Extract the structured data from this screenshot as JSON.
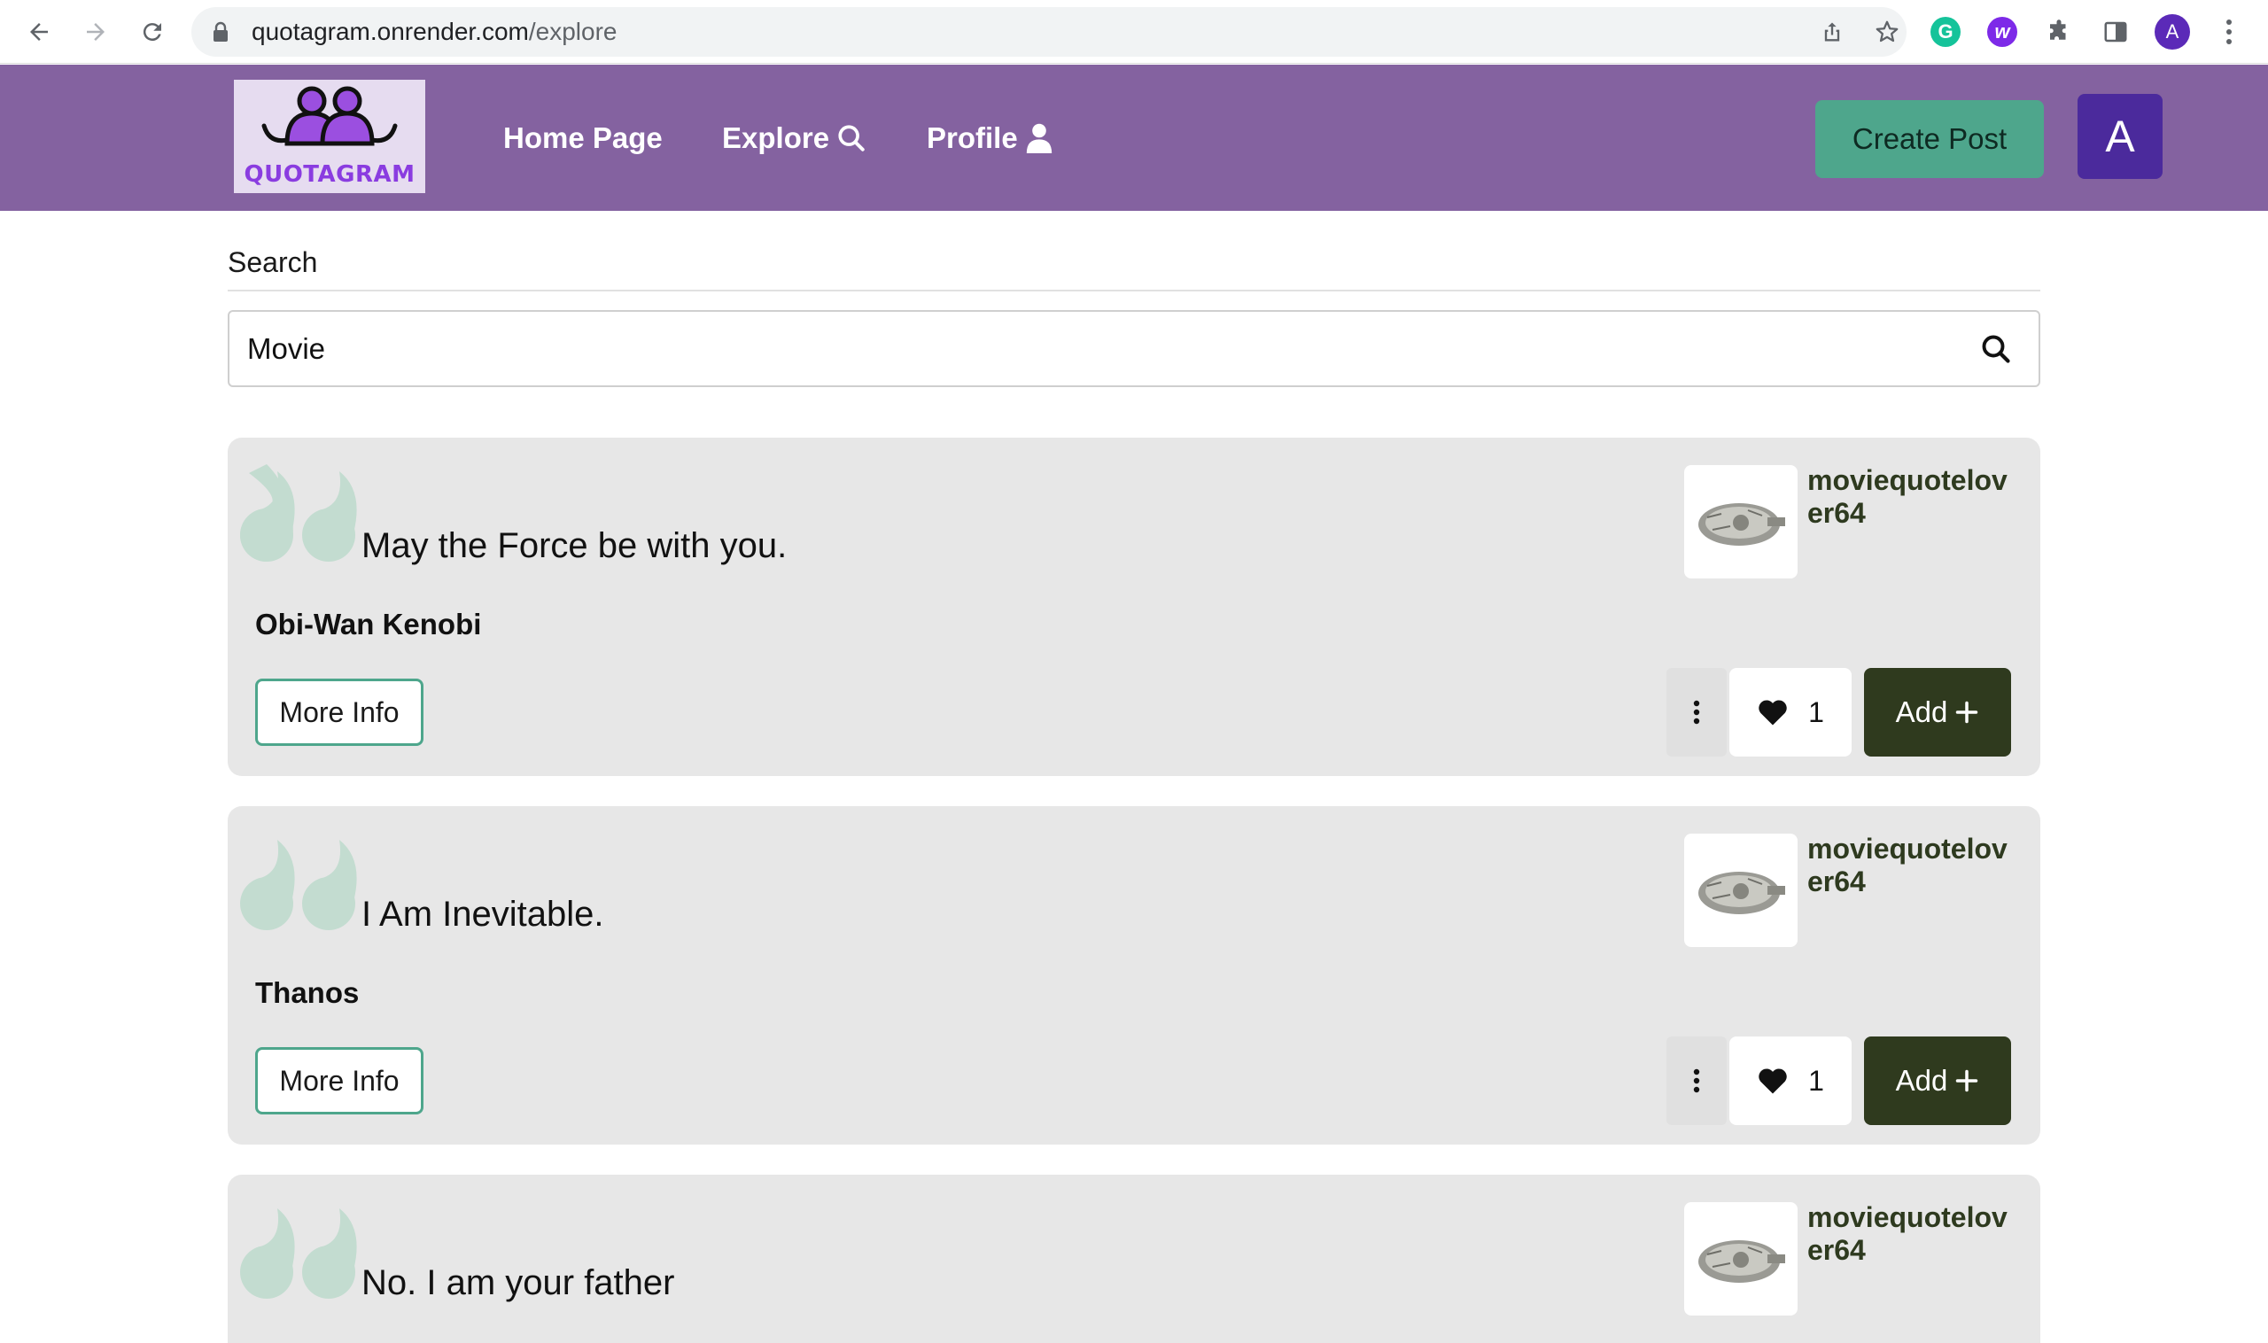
{
  "browser": {
    "url_host": "quotagram.onrender.com",
    "url_path": "/explore",
    "profile_initial": "A",
    "extensions": [
      "grammarly-icon",
      "wordtune-icon",
      "puzzle-icon",
      "sidepanel-icon"
    ]
  },
  "header": {
    "logo_text": "QUOTAGRAM",
    "nav": {
      "home": "Home Page",
      "explore": "Explore",
      "profile": "Profile"
    },
    "create_post": "Create Post",
    "avatar_initial": "A"
  },
  "search": {
    "label": "Search",
    "value": "Movie"
  },
  "posts": [
    {
      "quote": "May the Force be with you.",
      "author": "Obi-Wan Kenobi",
      "username": "moviequotelover64",
      "likes": "1",
      "more_info": "More Info",
      "add": "Add"
    },
    {
      "quote": "I Am Inevitable.",
      "author": "Thanos",
      "username": "moviequotelover64",
      "likes": "1",
      "more_info": "More Info",
      "add": "Add"
    },
    {
      "quote": "No. I am your father",
      "username": "moviequotelover64"
    }
  ],
  "colors": {
    "header_bg": "#8462a0",
    "create_post_bg": "#4ea68c",
    "avatar_bg": "#4b2a9c",
    "card_bg": "#e7e7e7",
    "add_bg": "#2f3a1e",
    "quote_mark": "#c3dcd0"
  }
}
